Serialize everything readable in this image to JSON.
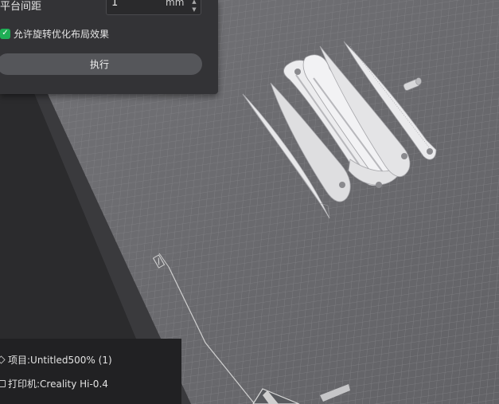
{
  "arrange_panel": {
    "spacing_label": "平台间距",
    "spacing_value": "1",
    "spacing_unit": "mm",
    "allow_rotation_label": "允许旋转优化布局效果",
    "allow_rotation_checked": true,
    "run_label": "执行"
  },
  "info_panel": {
    "project_text": "项目:Untitled500% (1)",
    "printer_text": "打印机:Creality Hi-0.4"
  },
  "icons": {
    "up": "spin-up-icon",
    "down": "spin-down-icon",
    "check": "check-icon",
    "project": "cube-icon",
    "printer": "printer-icon"
  },
  "colors": {
    "background": "#2b2b2d",
    "plate": "#6e6e72",
    "grid": "#8a8a8e",
    "panel": "#333336",
    "accent": "#1fae55"
  }
}
